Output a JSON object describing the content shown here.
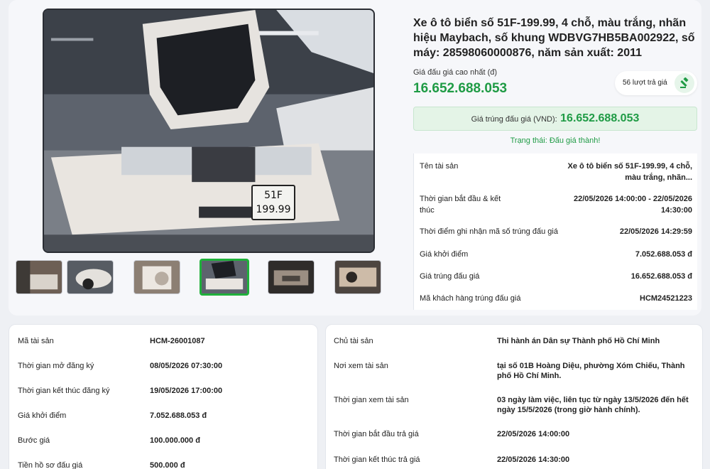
{
  "listing": {
    "title": "Xe ô tô biển số 51F-199.99, 4 chỗ, màu trắng, nhãn hiệu Maybach, số khung WDBVG7HB5BA002922, số máy: 28598060000876, năm sản xuất: 2011",
    "highest_bid_label": "Giá đấu giá cao nhất (đ)",
    "highest_bid_value": "16.652.688.053",
    "bid_count": "56 lượt trả giá",
    "winning_label": "Giá trúng đấu giá (VND):",
    "winning_value": "16.652.688.053",
    "status": "Trạng thái: Đấu giá thành!",
    "plate_line1": "51F",
    "plate_line2": "199.99"
  },
  "info": [
    {
      "key": "Tên tài sản",
      "value": "Xe ô tô biển số 51F-199.99, 4 chỗ, màu trắng, nhãn..."
    },
    {
      "key": "Thời gian bắt đầu & kết thúc",
      "value": "22/05/2026 14:00:00 - 22/05/2026 14:30:00"
    },
    {
      "key": "Thời điểm ghi nhận mã số trúng đấu giá",
      "value": "22/05/2026 14:29:59"
    },
    {
      "key": "Giá khởi điểm",
      "value": "7.052.688.053 đ"
    },
    {
      "key": "Giá trúng đấu giá",
      "value": "16.652.688.053 đ"
    },
    {
      "key": "Mã khách hàng trúng đấu giá",
      "value": "HCM24521223"
    }
  ],
  "left_details": [
    {
      "key": "Mã tài sản",
      "value": "HCM-26001087"
    },
    {
      "key": "Thời gian mở đăng ký",
      "value": "08/05/2026 07:30:00"
    },
    {
      "key": "Thời gian kết thúc đăng ký",
      "value": "19/05/2026 17:00:00"
    },
    {
      "key": "Giá khởi điểm",
      "value": "7.052.688.053 đ"
    },
    {
      "key": "Bước giá",
      "value": "100.000.000 đ"
    },
    {
      "key": "Tiền hồ sơ đấu giá",
      "value": "500.000 đ"
    }
  ],
  "right_details": [
    {
      "key": "Chủ tài sản",
      "value": "Thi hành án Dân sự Thành phố Hồ Chí Minh"
    },
    {
      "key": "Nơi xem tài sản",
      "value": "tại số 01B Hoàng Diệu, phường Xóm Chiếu, Thành phố Hồ Chí Minh."
    },
    {
      "key": "Thời gian xem tài sản",
      "value": "03 ngày làm việc, liên tục từ ngày 13/5/2026 đến hết ngày 15/5/2026 (trong giờ hành chính)."
    },
    {
      "key": "Thời gian bắt đầu trả giá",
      "value": "22/05/2026 14:00:00"
    },
    {
      "key": "Thời gian kết thúc trả giá",
      "value": "22/05/2026 14:30:00"
    }
  ],
  "colors": {
    "accent_green": "#1f9b45",
    "win_bg": "#e4f4e7"
  }
}
